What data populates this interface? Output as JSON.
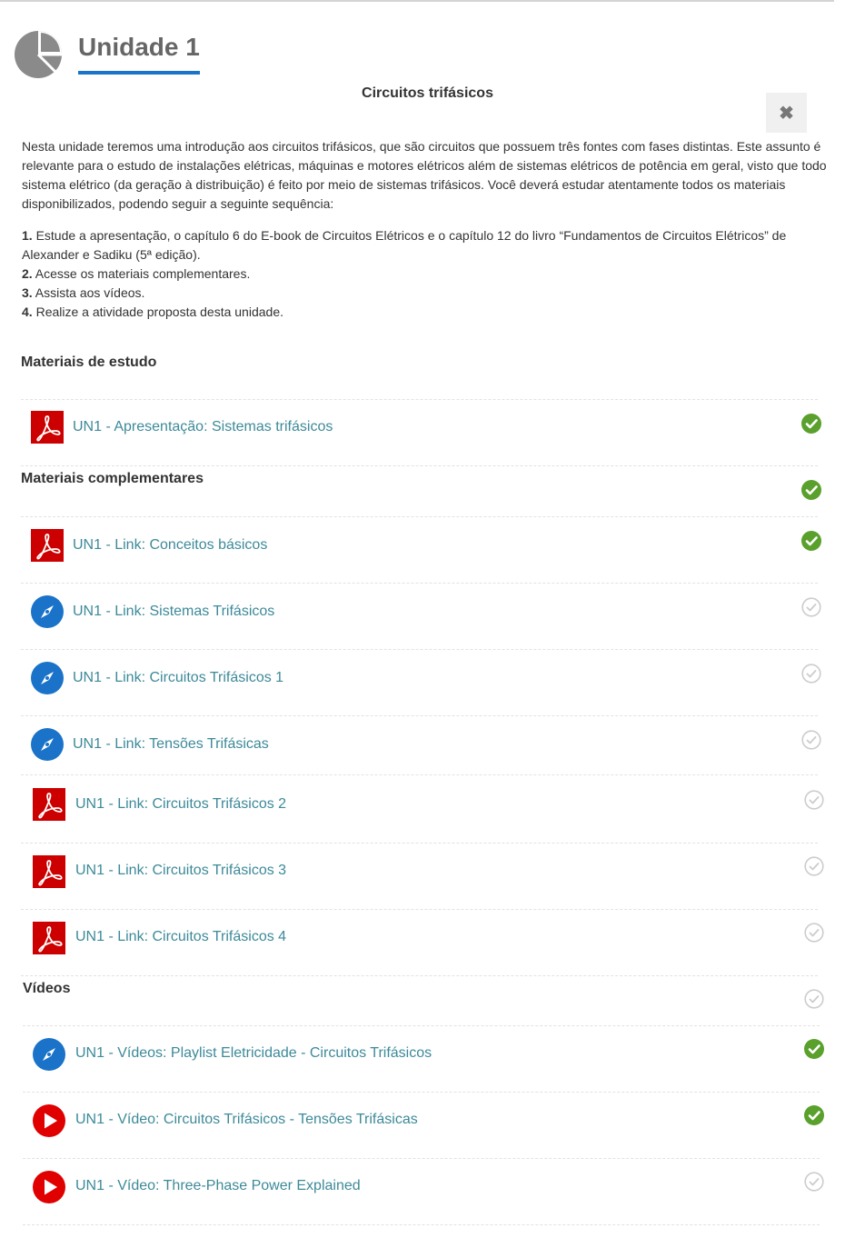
{
  "header": {
    "unit_title": "Unidade 1",
    "subtitle": "Circuitos trifásicos",
    "close_symbol": "✖",
    "icon": "pie-chart-icon"
  },
  "intro": "Nesta unidade teremos uma introdução aos circuitos trifásicos, que são circuitos que possuem três fontes com fases distintas. Este assunto é relevante para o estudo de instalações elétricas, máquinas e motores elétricos além de sistemas elétricos de potência em geral, visto que todo sistema elétrico (da geração à distribuição) é feito por meio de sistemas trifásicos. Você deverá estudar atentamente todos os materiais disponibilizados, podendo seguir a seguinte sequência:",
  "steps": [
    {
      "num": "1.",
      "text": " Estude a apresentação, o capítulo 6 do E-book de Circuitos Elétricos e o capítulo 12 do livro “Fundamentos de Circuitos Elétricos” de Alexander e Sadiku (5ª edição)."
    },
    {
      "num": "2.",
      "text": " Acesse os materiais complementares."
    },
    {
      "num": "3.",
      "text": " Assista aos vídeos."
    },
    {
      "num": "4.",
      "text": " Realize a atividade proposta desta unidade."
    }
  ],
  "sections": {
    "estudo": "Materiais de estudo",
    "complementares": "Materiais complementares",
    "videos": "Vídeos"
  },
  "items": [
    {
      "label": "UN1 - Apresentação: Sistemas trifásicos",
      "icon": "pdf-icon",
      "status": "complete"
    },
    {
      "label": "UN1 - Link: Conceitos básicos",
      "icon": "pdf-icon",
      "status": "complete"
    },
    {
      "label": "UN1 - Link: Sistemas Trifásicos",
      "icon": "compass-icon",
      "status": "incomplete"
    },
    {
      "label": "UN1 - Link: Circuitos Trifásicos 1",
      "icon": "compass-icon",
      "status": "incomplete"
    },
    {
      "label": "UN1 - Link: Tensões Trifásicas",
      "icon": "compass-icon",
      "status": "incomplete"
    },
    {
      "label": "UN1 - Link: Circuitos Trifásicos 2",
      "icon": "pdf-icon",
      "status": "incomplete"
    },
    {
      "label": "UN1 - Link: Circuitos Trifásicos 3",
      "icon": "pdf-icon",
      "status": "incomplete"
    },
    {
      "label": "UN1 - Link: Circuitos Trifásicos 4",
      "icon": "pdf-icon",
      "status": "incomplete"
    },
    {
      "label": "UN1 - Vídeos: Playlist Eletricidade - Circuitos Trifásicos",
      "icon": "compass-icon",
      "status": "complete"
    },
    {
      "label": "UN1 - Vídeo: Circuitos Trifásicos - Tensões Trifásicas",
      "icon": "play-icon",
      "status": "complete"
    },
    {
      "label": "UN1 - Vídeo: Three-Phase Power Explained",
      "icon": "play-icon",
      "status": "incomplete"
    }
  ],
  "section_status": {
    "complementares": "complete",
    "videos": "incomplete"
  },
  "colors": {
    "link": "#3d8a99",
    "accent_blue": "#1a73c8",
    "check_green": "#5aa02c",
    "pdf_red": "#cc0000",
    "play_red": "#e00000"
  }
}
